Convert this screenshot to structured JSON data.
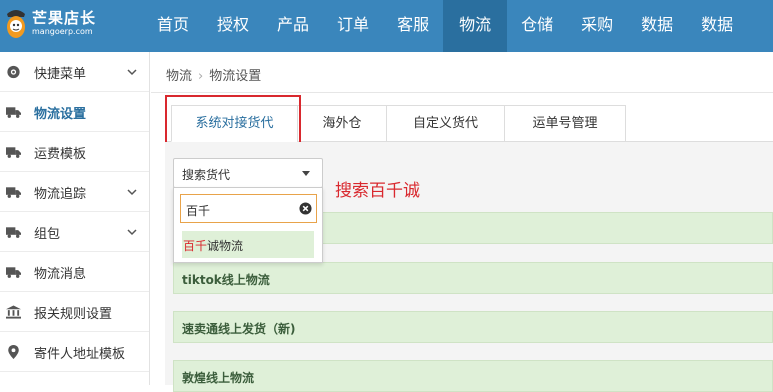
{
  "brand": {
    "title": "芒果店长",
    "url": "mangoerp.com"
  },
  "nav": [
    "首页",
    "授权",
    "产品",
    "订单",
    "客服",
    "物流",
    "仓储",
    "采购",
    "数据",
    "数据"
  ],
  "sidebar": [
    {
      "label": "快捷菜单",
      "icon": "dashboard-icon",
      "has_children": true
    },
    {
      "label": "物流设置",
      "icon": "truck-icon",
      "has_children": false,
      "active": true
    },
    {
      "label": "运费模板",
      "icon": "truck-icon",
      "has_children": false
    },
    {
      "label": "物流追踪",
      "icon": "truck-icon",
      "has_children": true
    },
    {
      "label": "组包",
      "icon": "truck-icon",
      "has_children": true
    },
    {
      "label": "物流消息",
      "icon": "truck-icon",
      "has_children": false
    },
    {
      "label": "报关规则设置",
      "icon": "bank-icon",
      "has_children": false
    },
    {
      "label": "寄件人地址模板",
      "icon": "location-pin-icon",
      "has_children": false
    }
  ],
  "breadcrumb": [
    "物流",
    "物流设置"
  ],
  "tabs": [
    "系统对接货代",
    "海外仓",
    "自定义货代",
    "运单号管理"
  ],
  "active_tab": "系统对接货代",
  "select": {
    "label": "搜索货代"
  },
  "dropdown": {
    "search_value": "百千",
    "option": {
      "match": "百千",
      "rest": "诚物流"
    }
  },
  "annotation": "搜索百千诚",
  "rows": [
    "tiktok线上物流",
    "速卖通线上发货（新)",
    "敦煌线上物流"
  ],
  "colors": {
    "header": "#3a86bc",
    "header_active": "#2a6f9f",
    "highlight": "#d9282e",
    "row_bg": "#dff0d8"
  }
}
